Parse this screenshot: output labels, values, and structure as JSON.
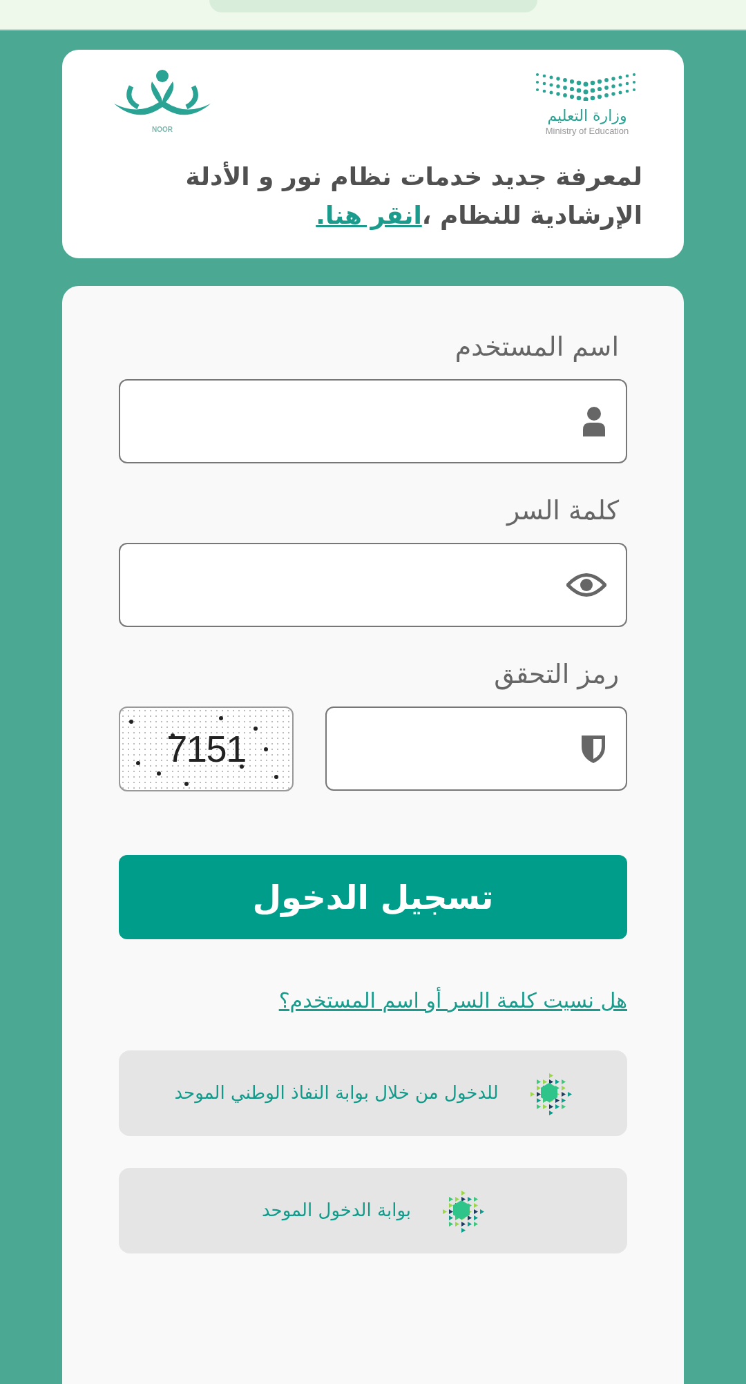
{
  "header": {
    "noor_logo": {
      "caption": "NOOR"
    },
    "ministry_logo": {
      "arabic": "وزارة التعليم",
      "english": "Ministry of Education"
    },
    "notice": "لمعرفة جديد خدمات نظام نور و الأدلة الإرشادية للنظام ،",
    "notice_link": "انقر هنا."
  },
  "login": {
    "fields": [
      {
        "label": "اسم المستخدم",
        "kind": "user"
      },
      {
        "label": "كلمة السر",
        "kind": "password"
      },
      {
        "label": "رمز التحقق",
        "kind": "captcha",
        "captcha": "7151"
      }
    ],
    "submit": "تسجيل الدخول",
    "forgot_link": "هل نسيت كلمة السر أو اسم المستخدم؟",
    "sso_buttons": [
      "للدخول من خلال بوابة النفاذ الوطني الموحد",
      "بوابة الدخول الموحد"
    ]
  }
}
